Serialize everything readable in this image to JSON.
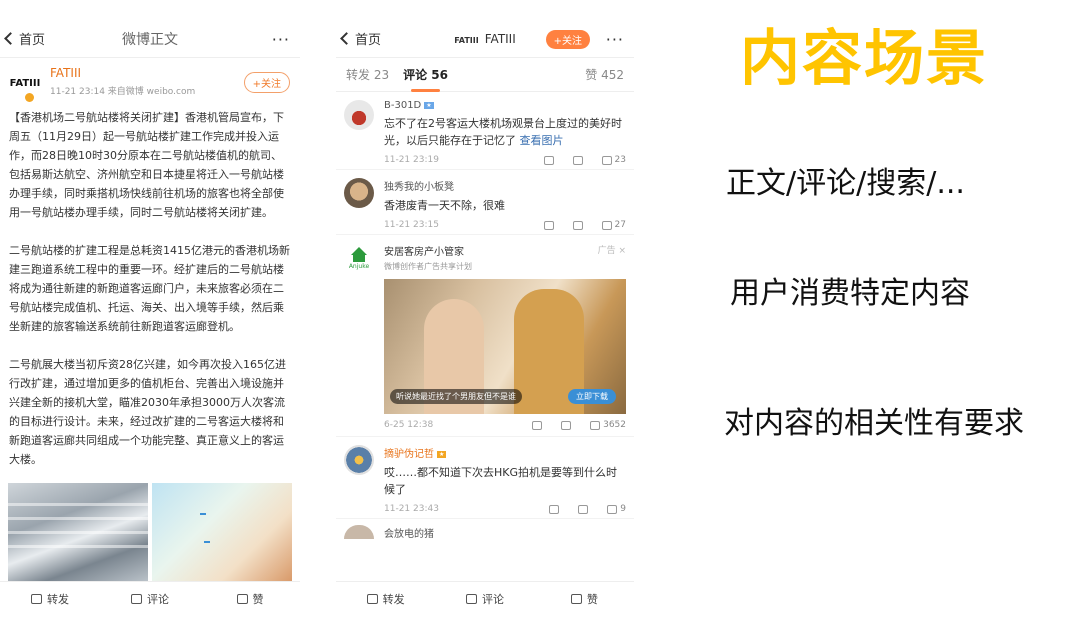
{
  "left_phone": {
    "nav": {
      "back": "首页",
      "title": "微博正文",
      "more": "···"
    },
    "author": {
      "logo": "FATIII",
      "name": "FATIII",
      "sub": "11-21 23:14  来自微博 weibo.com",
      "follow": "+关注"
    },
    "paragraphs": [
      "【香港机场二号航站楼将关闭扩建】香港机管局宣布，下周五（11月29日）起一号航站楼扩建工作完成并投入运作，而28日晚10时30分原本在二号航站楼值机的航司、包括易斯达航空、济州航空和日本捷星将迁入一号航站楼办理手续，同时乘搭机场快线前往机场的旅客也将全部使用一号航站楼办理手续，同时二号航站楼将关闭扩建。",
      "二号航站楼的扩建工程是总耗资1415亿港元的香港机场新建三跑道系统工程中的重要一环。经扩建后的二号航站楼将成为通往新建的新跑道客运廊门户，未来旅客必须在二号航站楼完成值机、托运、海关、出入境等手续，然后乘坐新建的旅客输送系统前往新跑道客运廊登机。",
      "二号航展大楼当初斥资28亿兴建，如今再次投入165亿进行改扩建，通过增加更多的值机柜台、完善出入境设施并兴建全新的接机大堂，瞄准2030年承担3000万人次客流的目标进行设计。未来，经过改扩建的二号客运大楼将和新跑道客运廊共同组成一个功能完整、真正意义上的客运大楼。"
    ],
    "bottom": {
      "repost": "转发",
      "comment": "评论",
      "like": "赞"
    }
  },
  "right_phone": {
    "nav": {
      "back": "首页",
      "logo": "FATIII",
      "title": "FATIII",
      "follow": "+关注",
      "more": "···"
    },
    "tabs": {
      "repost": "转发 23",
      "comments": "评论 56",
      "likes": "赞 452"
    },
    "comments": [
      {
        "name": "B-301D",
        "text": "忘不了在2号客运大楼机场观景台上度过的美好时光，以后只能存在于记忆了",
        "link": "查看图片",
        "time": "11-21 23:19",
        "likes": "23"
      },
      {
        "name": "独秀我的小板凳",
        "text": "香港废青一天不除，很难",
        "time": "11-21 23:15",
        "likes": "27"
      }
    ],
    "ad": {
      "logo_text": "Anjuke",
      "name": "安居客房产小管家",
      "sub": "微博创作者广告共享计划",
      "tag": "广告 ×",
      "caption": "听说她最近找了个男朋友但不是谁",
      "download": "立即下载",
      "time": "6-25 12:38",
      "likes": "3652"
    },
    "comment3": {
      "name": "摘驴伪记哲",
      "text": "哎……都不知道下次去HKG拍机是要等到什么时候了",
      "time": "11-21 23:43",
      "likes": "9"
    },
    "partial_name": "会放电的猪",
    "bottom": {
      "repost": "转发",
      "comment": "评论",
      "like": "赞"
    }
  },
  "right_text": {
    "headline": "内容场景",
    "line1": "正文/评论/搜索/...",
    "line2": "用户消费特定内容",
    "line3": "对内容的相关性有要求"
  }
}
